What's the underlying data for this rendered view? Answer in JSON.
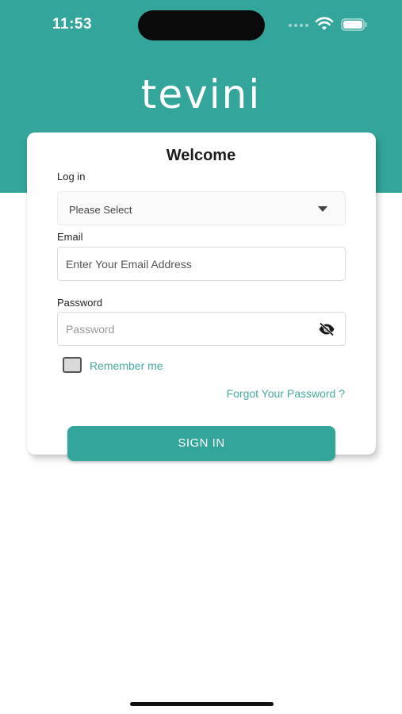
{
  "status_bar": {
    "time": "11:53"
  },
  "brand": {
    "logo_text": "tevini"
  },
  "login_card": {
    "title": "Welcome",
    "login_type": {
      "label": "Log in",
      "placeholder": "Please Select"
    },
    "email": {
      "label": "Email",
      "placeholder": "Enter Your Email Address"
    },
    "password": {
      "label": "Password",
      "placeholder": "Password"
    },
    "remember_me": {
      "label": "Remember me",
      "checked": false
    },
    "forgot_password": "Forgot Your Password ?",
    "sign_in": "SIGN IN"
  },
  "colors": {
    "brand_teal": "#34a59a",
    "link_teal": "#46aa9f",
    "background": "#ffffff"
  },
  "icons": {
    "dropdown": "caret-down-icon",
    "password_toggle": "eye-off-icon",
    "wifi": "wifi-icon",
    "battery": "battery-icon"
  }
}
